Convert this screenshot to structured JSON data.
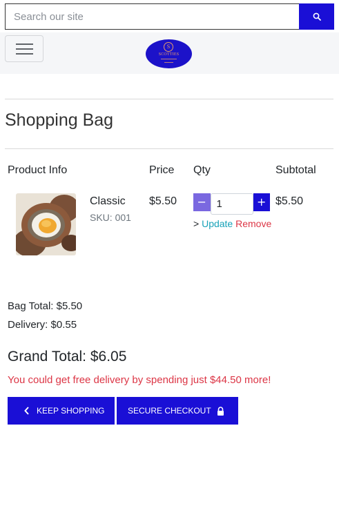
{
  "search": {
    "placeholder": "Search our site",
    "icon": "search-icon"
  },
  "navbar": {
    "toggler_icon": "hamburger-icon",
    "logo": {
      "monogram": "S",
      "name": "SCOTTIES",
      "color": "#1c12c9",
      "accent": "#e69b6a"
    }
  },
  "page": {
    "title": "Shopping Bag"
  },
  "table": {
    "headers": [
      "Product Info",
      "Price",
      "Qty",
      "Subtotal"
    ],
    "rows": [
      {
        "image": "scotch-egg-photo",
        "name": "Classic",
        "sku": "SKU: 001",
        "price": "$5.50",
        "qty": "1",
        "subtotal": "$5.50"
      }
    ],
    "qty_controls": {
      "minus": "−",
      "plus": "+",
      "caret": ">",
      "update": "Update",
      "remove": "Remove"
    }
  },
  "totals": {
    "bag_total": "Bag Total: $5.50",
    "delivery": "Delivery: $0.55",
    "grand_total": "Grand Total: $6.05",
    "free_delivery_msg": "You could get free delivery by spending just $44.50 more!"
  },
  "buttons": {
    "keep_shopping": "Keep Shopping",
    "secure_checkout": "Secure Checkout"
  },
  "colors": {
    "primary": "#1a0fd6",
    "qty_minus": "#7a68e0",
    "info": "#17a2b8",
    "danger": "#dc3545",
    "navbar_bg": "#f5f6f8"
  }
}
